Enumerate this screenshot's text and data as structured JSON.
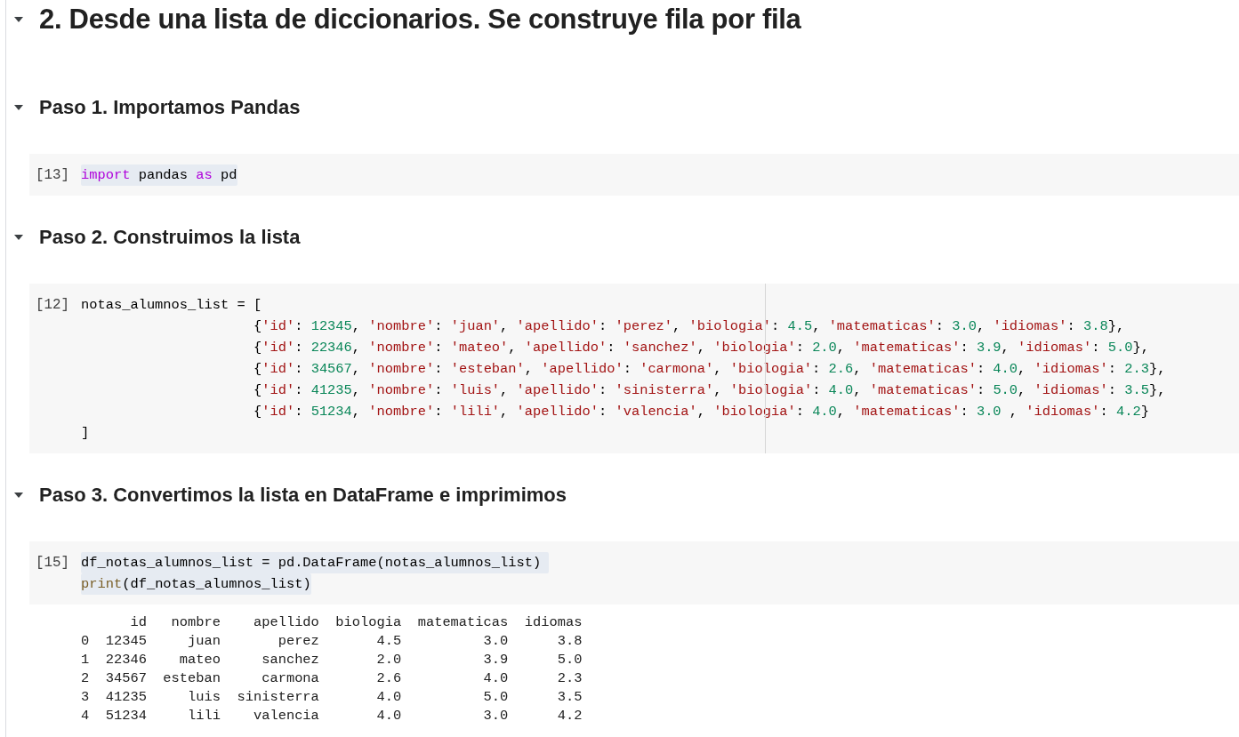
{
  "title": {
    "text": "2. Desde una lista de diccionarios. Se construye fila por fila",
    "expanded": true
  },
  "steps": [
    {
      "heading": "Paso 1. Importamos Pandas",
      "expanded": true,
      "cell": {
        "prompt": "[13]",
        "highlighted": true,
        "lines": [
          {
            "tokens": [
              {
                "kind": "keyword",
                "text": "import"
              },
              {
                "kind": "plain",
                "text": " pandas "
              },
              {
                "kind": "keyword",
                "text": "as"
              },
              {
                "kind": "plain",
                "text": " pd"
              }
            ]
          }
        ]
      }
    },
    {
      "heading": "Paso 2. Construimos la lista",
      "expanded": true,
      "cell": {
        "prompt": "[12]",
        "highlighted": false,
        "ruler": true,
        "lines": [
          {
            "tokens": [
              {
                "kind": "plain",
                "text": "notas_alumnos_list = ["
              }
            ]
          },
          {
            "tokens": [
              {
                "kind": "plain",
                "text": "                     {"
              },
              {
                "kind": "string",
                "text": "'id'"
              },
              {
                "kind": "plain",
                "text": ": "
              },
              {
                "kind": "number",
                "text": "12345"
              },
              {
                "kind": "plain",
                "text": ", "
              },
              {
                "kind": "string",
                "text": "'nombre'"
              },
              {
                "kind": "plain",
                "text": ": "
              },
              {
                "kind": "string",
                "text": "'juan'"
              },
              {
                "kind": "plain",
                "text": ", "
              },
              {
                "kind": "string",
                "text": "'apellido'"
              },
              {
                "kind": "plain",
                "text": ": "
              },
              {
                "kind": "string",
                "text": "'perez'"
              },
              {
                "kind": "plain",
                "text": ", "
              },
              {
                "kind": "string",
                "text": "'biologia'"
              },
              {
                "kind": "plain",
                "text": ": "
              },
              {
                "kind": "number",
                "text": "4.5"
              },
              {
                "kind": "plain",
                "text": ", "
              },
              {
                "kind": "string",
                "text": "'matematicas'"
              },
              {
                "kind": "plain",
                "text": ": "
              },
              {
                "kind": "number",
                "text": "3.0"
              },
              {
                "kind": "plain",
                "text": ", "
              },
              {
                "kind": "string",
                "text": "'idiomas'"
              },
              {
                "kind": "plain",
                "text": ": "
              },
              {
                "kind": "number",
                "text": "3.8"
              },
              {
                "kind": "plain",
                "text": "},"
              }
            ]
          },
          {
            "tokens": [
              {
                "kind": "plain",
                "text": "                     {"
              },
              {
                "kind": "string",
                "text": "'id'"
              },
              {
                "kind": "plain",
                "text": ": "
              },
              {
                "kind": "number",
                "text": "22346"
              },
              {
                "kind": "plain",
                "text": ", "
              },
              {
                "kind": "string",
                "text": "'nombre'"
              },
              {
                "kind": "plain",
                "text": ": "
              },
              {
                "kind": "string",
                "text": "'mateo'"
              },
              {
                "kind": "plain",
                "text": ", "
              },
              {
                "kind": "string",
                "text": "'apellido'"
              },
              {
                "kind": "plain",
                "text": ": "
              },
              {
                "kind": "string",
                "text": "'sanchez'"
              },
              {
                "kind": "plain",
                "text": ", "
              },
              {
                "kind": "string",
                "text": "'biologia'"
              },
              {
                "kind": "plain",
                "text": ": "
              },
              {
                "kind": "number",
                "text": "2.0"
              },
              {
                "kind": "plain",
                "text": ", "
              },
              {
                "kind": "string",
                "text": "'matematicas'"
              },
              {
                "kind": "plain",
                "text": ": "
              },
              {
                "kind": "number",
                "text": "3.9"
              },
              {
                "kind": "plain",
                "text": ", "
              },
              {
                "kind": "string",
                "text": "'idiomas'"
              },
              {
                "kind": "plain",
                "text": ": "
              },
              {
                "kind": "number",
                "text": "5.0"
              },
              {
                "kind": "plain",
                "text": "},"
              }
            ]
          },
          {
            "tokens": [
              {
                "kind": "plain",
                "text": "                     {"
              },
              {
                "kind": "string",
                "text": "'id'"
              },
              {
                "kind": "plain",
                "text": ": "
              },
              {
                "kind": "number",
                "text": "34567"
              },
              {
                "kind": "plain",
                "text": ", "
              },
              {
                "kind": "string",
                "text": "'nombre'"
              },
              {
                "kind": "plain",
                "text": ": "
              },
              {
                "kind": "string",
                "text": "'esteban'"
              },
              {
                "kind": "plain",
                "text": ", "
              },
              {
                "kind": "string",
                "text": "'apellido'"
              },
              {
                "kind": "plain",
                "text": ": "
              },
              {
                "kind": "string",
                "text": "'carmona'"
              },
              {
                "kind": "plain",
                "text": ", "
              },
              {
                "kind": "string",
                "text": "'biologia'"
              },
              {
                "kind": "plain",
                "text": ": "
              },
              {
                "kind": "number",
                "text": "2.6"
              },
              {
                "kind": "plain",
                "text": ", "
              },
              {
                "kind": "string",
                "text": "'matematicas'"
              },
              {
                "kind": "plain",
                "text": ": "
              },
              {
                "kind": "number",
                "text": "4.0"
              },
              {
                "kind": "plain",
                "text": ", "
              },
              {
                "kind": "string",
                "text": "'idiomas'"
              },
              {
                "kind": "plain",
                "text": ": "
              },
              {
                "kind": "number",
                "text": "2.3"
              },
              {
                "kind": "plain",
                "text": "},"
              }
            ]
          },
          {
            "tokens": [
              {
                "kind": "plain",
                "text": "                     {"
              },
              {
                "kind": "string",
                "text": "'id'"
              },
              {
                "kind": "plain",
                "text": ": "
              },
              {
                "kind": "number",
                "text": "41235"
              },
              {
                "kind": "plain",
                "text": ", "
              },
              {
                "kind": "string",
                "text": "'nombre'"
              },
              {
                "kind": "plain",
                "text": ": "
              },
              {
                "kind": "string",
                "text": "'luis'"
              },
              {
                "kind": "plain",
                "text": ", "
              },
              {
                "kind": "string",
                "text": "'apellido'"
              },
              {
                "kind": "plain",
                "text": ": "
              },
              {
                "kind": "string",
                "text": "'sinisterra'"
              },
              {
                "kind": "plain",
                "text": ", "
              },
              {
                "kind": "string",
                "text": "'biologia'"
              },
              {
                "kind": "plain",
                "text": ": "
              },
              {
                "kind": "number",
                "text": "4.0"
              },
              {
                "kind": "plain",
                "text": ", "
              },
              {
                "kind": "string",
                "text": "'matematicas'"
              },
              {
                "kind": "plain",
                "text": ": "
              },
              {
                "kind": "number",
                "text": "5.0"
              },
              {
                "kind": "plain",
                "text": ", "
              },
              {
                "kind": "string",
                "text": "'idiomas'"
              },
              {
                "kind": "plain",
                "text": ": "
              },
              {
                "kind": "number",
                "text": "3.5"
              },
              {
                "kind": "plain",
                "text": "},"
              }
            ]
          },
          {
            "tokens": [
              {
                "kind": "plain",
                "text": "                     {"
              },
              {
                "kind": "string",
                "text": "'id'"
              },
              {
                "kind": "plain",
                "text": ": "
              },
              {
                "kind": "number",
                "text": "51234"
              },
              {
                "kind": "plain",
                "text": ", "
              },
              {
                "kind": "string",
                "text": "'nombre'"
              },
              {
                "kind": "plain",
                "text": ": "
              },
              {
                "kind": "string",
                "text": "'lili'"
              },
              {
                "kind": "plain",
                "text": ", "
              },
              {
                "kind": "string",
                "text": "'apellido'"
              },
              {
                "kind": "plain",
                "text": ": "
              },
              {
                "kind": "string",
                "text": "'valencia'"
              },
              {
                "kind": "plain",
                "text": ", "
              },
              {
                "kind": "string",
                "text": "'biologia'"
              },
              {
                "kind": "plain",
                "text": ": "
              },
              {
                "kind": "number",
                "text": "4.0"
              },
              {
                "kind": "plain",
                "text": ", "
              },
              {
                "kind": "string",
                "text": "'matematicas'"
              },
              {
                "kind": "plain",
                "text": ": "
              },
              {
                "kind": "number",
                "text": "3.0"
              },
              {
                "kind": "plain",
                "text": " , "
              },
              {
                "kind": "string",
                "text": "'idiomas'"
              },
              {
                "kind": "plain",
                "text": ": "
              },
              {
                "kind": "number",
                "text": "4.2"
              },
              {
                "kind": "plain",
                "text": "}"
              }
            ]
          },
          {
            "tokens": [
              {
                "kind": "plain",
                "text": "]"
              }
            ]
          }
        ]
      }
    },
    {
      "heading": "Paso 3. Convertimos la lista en DataFrame e imprimimos",
      "expanded": true,
      "cell": {
        "prompt": "[15]",
        "highlighted": true,
        "lines": [
          {
            "tokens": [
              {
                "kind": "plain",
                "text": "df_notas_alumnos_list = pd.DataFrame(notas_alumnos_list) "
              }
            ]
          },
          {
            "tokens": [
              {
                "kind": "function",
                "text": "print"
              },
              {
                "kind": "plain",
                "text": "(df_notas_alumnos_list)"
              }
            ]
          }
        ],
        "output": [
          "      id   nombre    apellido  biologia  matematicas  idiomas",
          "0  12345     juan       perez       4.5          3.0      3.8",
          "1  22346    mateo     sanchez       2.0          3.9      5.0",
          "2  34567  esteban     carmona       2.6          4.0      2.3",
          "3  41235     luis  sinisterra       4.0          5.0      3.5",
          "4  51234     lili    valencia       4.0          3.0      4.2"
        ]
      }
    }
  ]
}
